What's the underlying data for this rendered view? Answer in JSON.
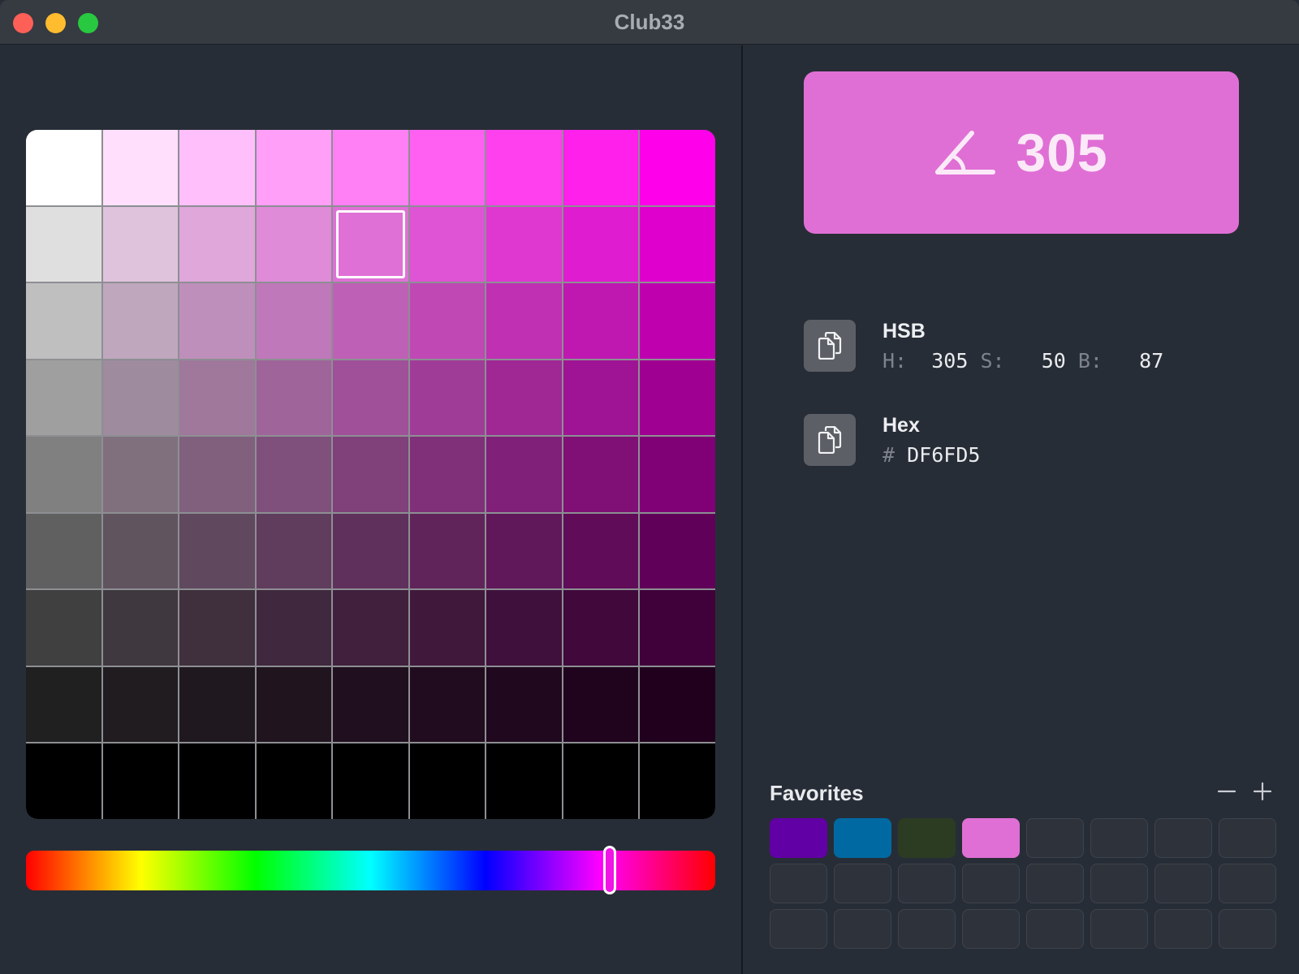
{
  "window": {
    "title": "Club33",
    "traffic_lights": [
      "#fe5f57",
      "#febc2e",
      "#28c840"
    ]
  },
  "grid": {
    "rows": 9,
    "cols": 9,
    "hue": 305,
    "selected": {
      "row": 1,
      "col": 4
    }
  },
  "hue_slider": {
    "value": 305,
    "max": 360,
    "thumb_color": "#f014e5"
  },
  "preview": {
    "color": "#df6fd5",
    "icon": "angle-icon",
    "value": "305"
  },
  "hsb": {
    "label": "HSB",
    "h_label": "H:",
    "h": "305",
    "s_label": "S:",
    "s": "50",
    "b_label": "B:",
    "b": "87",
    "copy_icon": "copy-icon"
  },
  "hex": {
    "label": "Hex",
    "prefix": "#",
    "value": "DF6FD5",
    "copy_icon": "copy-icon"
  },
  "favorites": {
    "title": "Favorites",
    "remove_icon": "minus-icon",
    "add_icon": "plus-icon",
    "slots": [
      "#6100a4",
      "#0069a2",
      "#2b3c23",
      "#df6fd5",
      null,
      null,
      null,
      null,
      null,
      null,
      null,
      null,
      null,
      null,
      null,
      null,
      null,
      null,
      null,
      null,
      null,
      null,
      null,
      null
    ]
  }
}
